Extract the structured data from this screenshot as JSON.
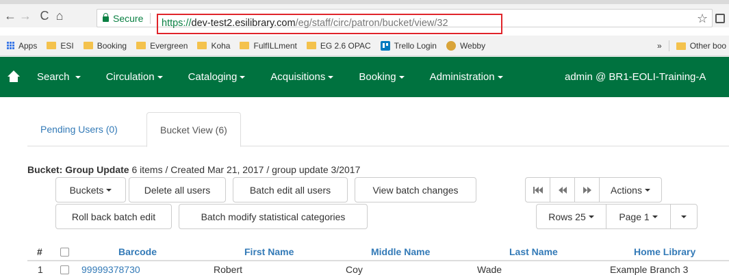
{
  "browser": {
    "secure_label": "Secure",
    "url_scheme": "https://",
    "url_host": "dev-test2.esilibrary.com",
    "url_path": "/eg/staff/circ/patron/bucket/view/32",
    "bookmarks": [
      "Apps",
      "ESI",
      "Booking",
      "Evergreen",
      "Koha",
      "FulfILLment",
      "EG 2.6 OPAC",
      "Trello Login",
      "Webby"
    ],
    "overflow_label": "»",
    "other_bookmarks": "Other boo"
  },
  "navbar": {
    "items": [
      "Search",
      "Circulation",
      "Cataloging",
      "Acquisitions",
      "Booking",
      "Administration"
    ],
    "user": "admin @ BR1-EOLI-Training-A",
    "bg_color": "#00723f"
  },
  "tabs": [
    {
      "label": "Pending Users (0)",
      "active": false
    },
    {
      "label": "Bucket View (6)",
      "active": true
    }
  ],
  "bucket": {
    "prefix": "Bucket: Group Update",
    "details": " 6 items / Created Mar 21, 2017 / group update 3/2017"
  },
  "toolbar": {
    "buckets": "Buckets",
    "delete_all": "Delete all users",
    "batch_edit": "Batch edit all users",
    "view_changes": "View batch changes",
    "rollback": "Roll back batch edit",
    "batch_modify": "Batch modify statistical categories",
    "actions": "Actions",
    "rows": "Rows 25",
    "page": "Page 1"
  },
  "table": {
    "headers": [
      "#",
      "Barcode",
      "First Name",
      "Middle Name",
      "Last Name",
      "Home Library"
    ],
    "rows": [
      {
        "index": "1",
        "barcode": "99999378730",
        "first": "Robert",
        "middle": "Coy",
        "last": "Wade",
        "library": "Example Branch 3"
      }
    ]
  }
}
